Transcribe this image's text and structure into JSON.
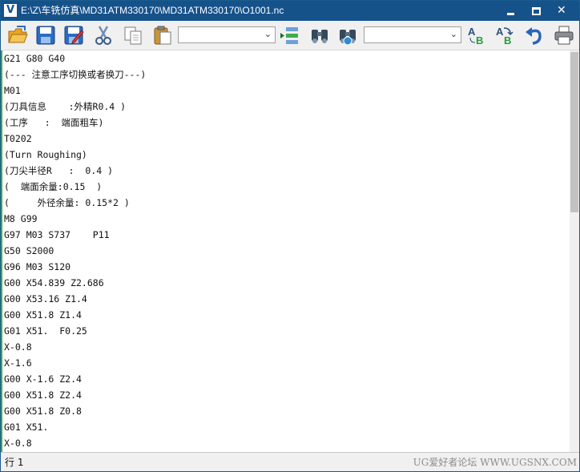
{
  "window": {
    "title": "E:\\Z\\车铣仿真\\MD31ATM330170\\MD31ATM330170\\O1001.nc"
  },
  "titlebar": {
    "app_icon": "V",
    "min_glyph": "—",
    "max_glyph": "□",
    "close_glyph": "✕"
  },
  "toolbar": {
    "icons": [
      "open-folder-icon",
      "save-icon",
      "save-as-icon",
      "cut-icon",
      "copy-icon",
      "paste-icon",
      "goto-line-icon",
      "find-icon",
      "find-next-icon",
      "font-icon",
      "replace-icon",
      "undo-icon",
      "print-icon"
    ],
    "combo_left_value": "",
    "combo_right_value": ""
  },
  "editor": {
    "lines": [
      "G21 G80 G40",
      "(--- 注意工序切换或者换刀---)",
      "M01",
      "(刀具信息    :外精R0.4 )",
      "(工序   :  端面粗车)",
      "T0202",
      "(Turn Roughing)",
      "(刀尖半径R   :  0.4 )",
      "(  端面余量:0.15  )",
      "(     外径余量: 0.15*2 )",
      "M8 G99",
      "G97 M03 S737    P11",
      "G50 S2000",
      "G96 M03 S120",
      "G00 X54.839 Z2.686",
      "G00 X53.16 Z1.4",
      "G00 X51.8 Z1.4",
      "G01 X51.  F0.25",
      "X-0.8",
      "X-1.6",
      "G00 X-1.6 Z2.4",
      "G00 X51.8 Z2.4",
      "G00 X51.8 Z0.8",
      "G01 X51.",
      "X-0.8"
    ]
  },
  "status": {
    "position": "行 1",
    "watermark": "UG爱好者论坛 WWW.UGSNX.COM"
  },
  "colors": {
    "titlebar": "#16528a",
    "gutter_marker": "#3cae3c"
  }
}
